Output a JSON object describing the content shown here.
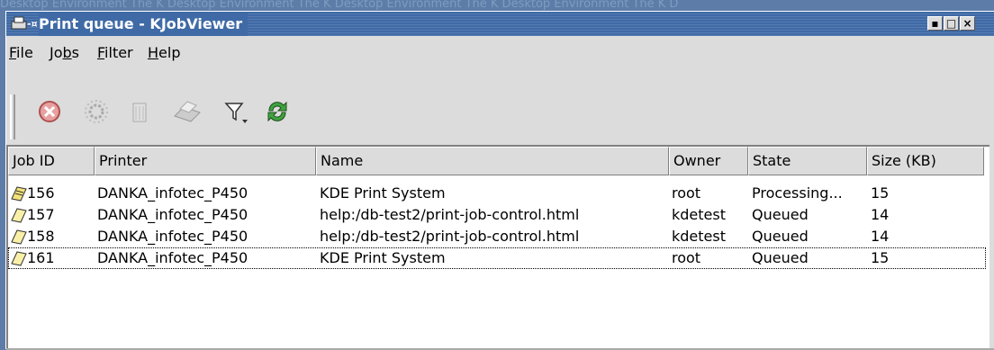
{
  "desktop": {
    "watermark": "Desktop Environment The K Desktop Environment The K Desktop Environment The K Desktop Environment The K D"
  },
  "window": {
    "title": "Print queue - KJobViewer",
    "buttons": {
      "minimize": "▪",
      "maximize": "□",
      "close": "×"
    }
  },
  "menubar": {
    "items": [
      {
        "accel": "F",
        "rest": "ile"
      },
      {
        "pre": "Jo",
        "accel": "b",
        "rest": "s"
      },
      {
        "accel": "F",
        "rest": "ilter"
      },
      {
        "accel": "H",
        "rest": "elp"
      }
    ]
  },
  "toolbar": {
    "icons": [
      "cancel-job-icon",
      "hold-job-icon",
      "remove-job-icon",
      "print-icon",
      "filter-icon",
      "refresh-icon"
    ]
  },
  "joblist": {
    "headers": [
      "Job ID",
      "Printer",
      "Name",
      "Owner",
      "State",
      "Size (KB)"
    ],
    "rows": [
      {
        "id": "156",
        "printer": "DANKA_infotec_P450",
        "name": "KDE Print System",
        "owner": "root",
        "state": "Processing...",
        "size": "15",
        "icon": "processing-job-icon"
      },
      {
        "id": "157",
        "printer": "DANKA_infotec_P450",
        "name": "help:/db-test2/print-job-control.html",
        "owner": "kdetest",
        "state": "Queued",
        "size": "14",
        "icon": "queued-job-icon"
      },
      {
        "id": "158",
        "printer": "DANKA_infotec_P450",
        "name": "help:/db-test2/print-job-control.html",
        "owner": "kdetest",
        "state": "Queued",
        "size": "14",
        "icon": "queued-job-icon"
      },
      {
        "id": "161",
        "printer": "DANKA_infotec_P450",
        "name": "KDE Print System",
        "owner": "root",
        "state": "Queued",
        "size": "15",
        "icon": "queued-job-icon"
      }
    ]
  },
  "colors": {
    "titlebar": "#3f6aa6",
    "window_bg": "#dcdcdc",
    "list_bg": "#ffffff"
  }
}
